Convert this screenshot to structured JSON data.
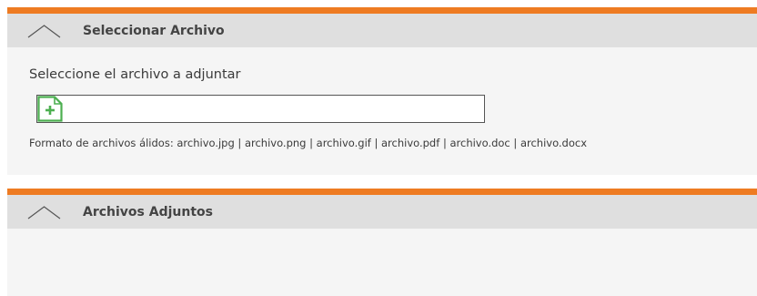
{
  "colors": {
    "accent": "#ee7b22",
    "header_bg": "#dfdfdf",
    "panel_bg": "#f5f5f5",
    "add_icon": "#4caf50"
  },
  "select_panel": {
    "title": "Seleccionar Archivo",
    "collapse_icon": "chevron-up-icon",
    "instruction": "Seleccione el archivo a adjuntar",
    "file_input": {
      "icon": "add-file-icon",
      "value": ""
    },
    "formats_text": "Formato de archivos álidos: archivo.jpg | archivo.png | archivo.gif | archivo.pdf | archivo.doc | archivo.docx"
  },
  "attachments_panel": {
    "title": "Archivos Adjuntos",
    "collapse_icon": "chevron-up-icon"
  }
}
